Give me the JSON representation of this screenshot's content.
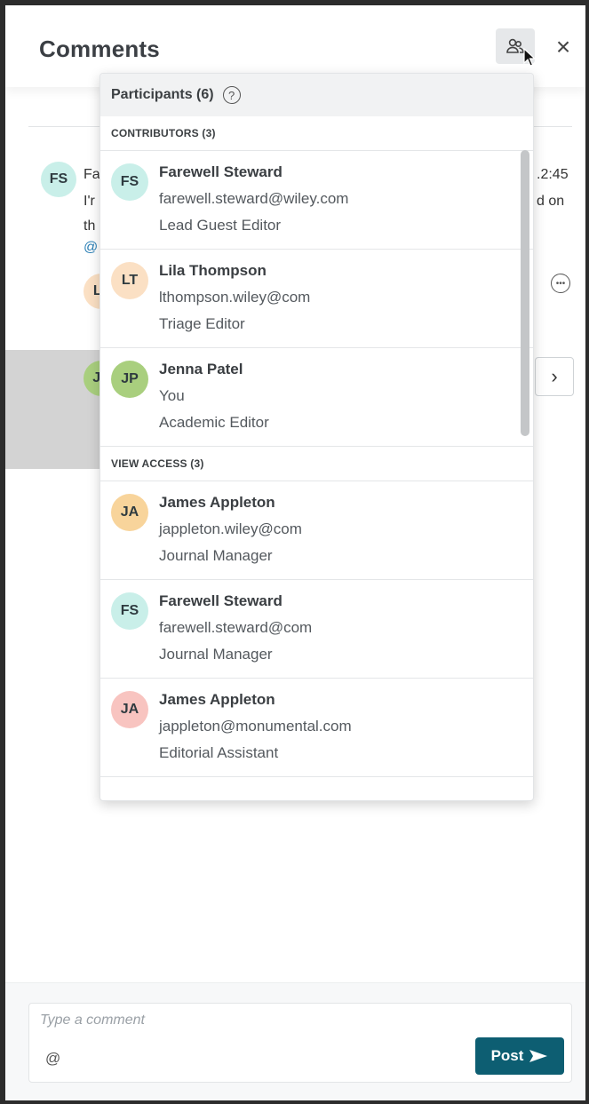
{
  "header": {
    "title": "Comments",
    "participants_icon": "participants-icon",
    "close_label": "×"
  },
  "background_thread": {
    "first_avatar_initials": "FS",
    "snippets": {
      "name_fragment": "Fa",
      "line2": "I'r",
      "line3": "th",
      "mention": "@",
      "time_fragment": ".2:45",
      "right_fragment": "d on"
    },
    "second_avatar_initials": "LT",
    "third_avatar_initials": "JP",
    "next_icon": "chevron-right-icon",
    "more_icon": "more-options-icon"
  },
  "participants_popover": {
    "title": "Participants (6)",
    "help_icon": "help-icon",
    "contributors_label": "CONTRIBUTORS (3)",
    "view_access_label": "VIEW ACCESS (3)",
    "contributors": [
      {
        "initials": "FS",
        "name": "Farewell Steward",
        "email": "farewell.steward@wiley.com",
        "role": "Lead Guest Editor",
        "color": "#c9efe9"
      },
      {
        "initials": "LT",
        "name": "Lila Thompson",
        "email": "lthompson.wiley@com",
        "role": "Triage Editor",
        "color": "#fbe0c4"
      },
      {
        "initials": "JP",
        "name": "Jenna Patel",
        "email": "You",
        "role": "Academic Editor",
        "color": "#a9cf7e"
      }
    ],
    "view_access": [
      {
        "initials": "JA",
        "name": "James Appleton",
        "email": "jappleton.wiley@com",
        "role": "Journal Manager",
        "color": "#f8d49b"
      },
      {
        "initials": "FS",
        "name": "Farewell Steward",
        "email": "farewell.steward@com",
        "role": "Journal Manager",
        "color": "#c9efe9"
      },
      {
        "initials": "JA",
        "name": "James Appleton",
        "email": "jappleton@monumental.com",
        "role": "Editorial Assistant",
        "color": "#f8c4c0"
      }
    ]
  },
  "composer": {
    "placeholder": "Type a comment",
    "mention_label": "@",
    "post_label": "Post",
    "post_color": "#0d5e72"
  }
}
